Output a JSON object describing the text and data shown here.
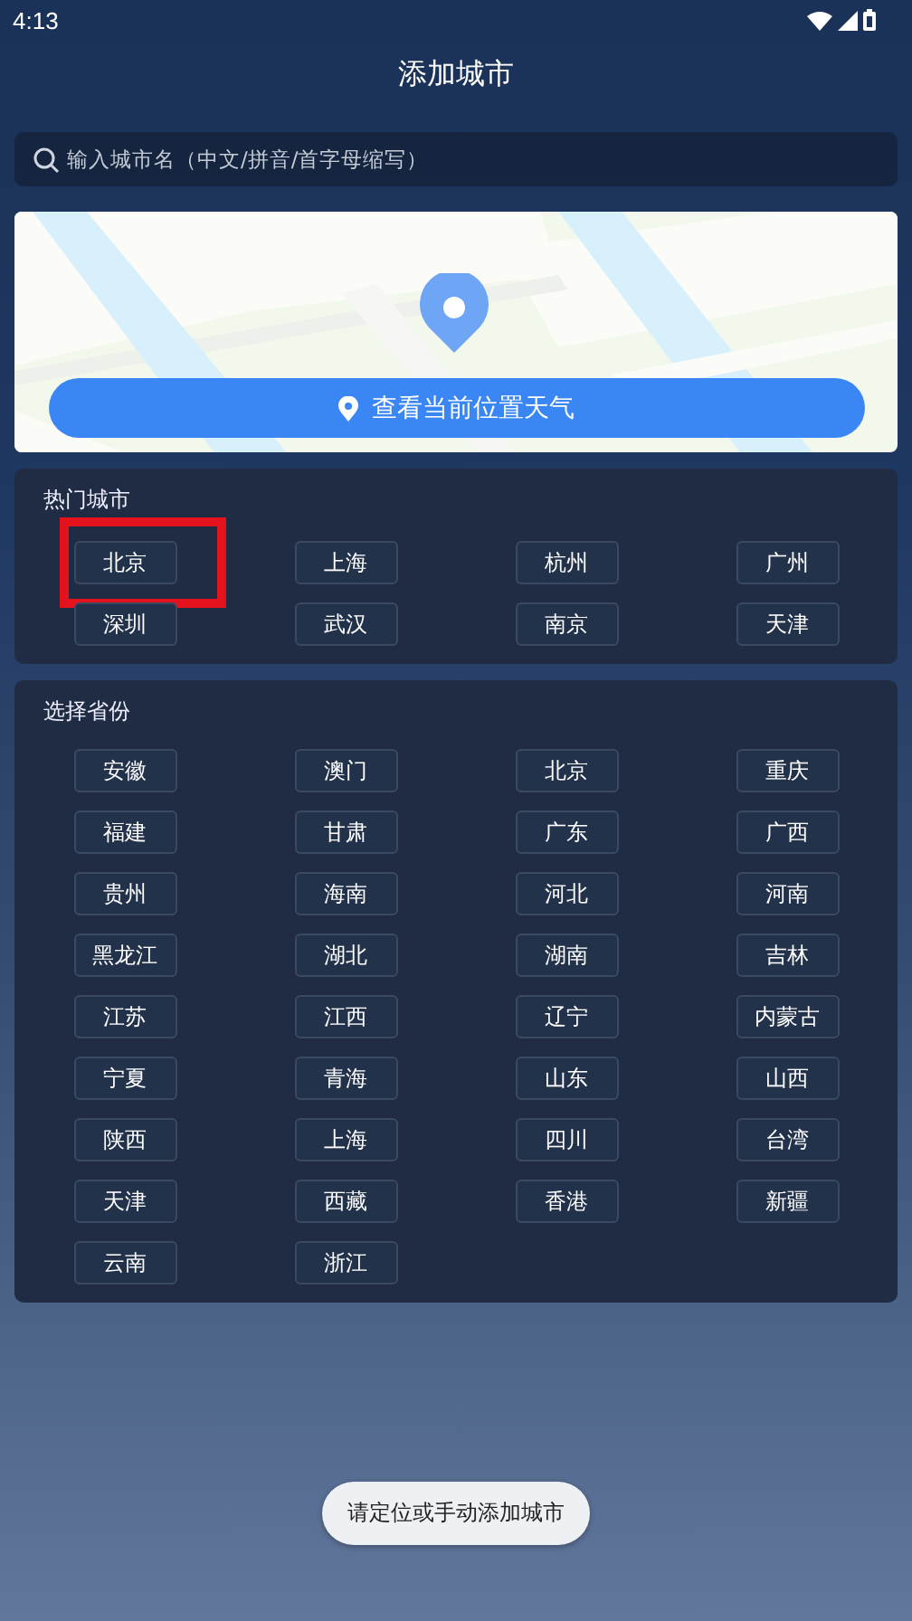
{
  "status_bar": {
    "time": "4:13"
  },
  "header": {
    "title": "添加城市"
  },
  "search": {
    "placeholder": "输入城市名（中文/拼音/首字母缩写）"
  },
  "map_card": {
    "kind": "picture",
    "button": "查看当前位置天气"
  },
  "hot_cities": {
    "title": "热门城市",
    "items": [
      {
        "label": "北京",
        "highlighted": true
      },
      {
        "label": "上海",
        "highlighted": false
      },
      {
        "label": "杭州",
        "highlighted": false
      },
      {
        "label": "广州",
        "highlighted": false
      },
      {
        "label": "深圳",
        "highlighted": false
      },
      {
        "label": "武汉",
        "highlighted": false
      },
      {
        "label": "南京",
        "highlighted": false
      },
      {
        "label": "天津",
        "highlighted": false
      }
    ]
  },
  "provinces": {
    "title": "选择省份",
    "items": [
      "安徽",
      "澳门",
      "北京",
      "重庆",
      "福建",
      "甘肃",
      "广东",
      "广西",
      "贵州",
      "海南",
      "河北",
      "河南",
      "黑龙江",
      "湖北",
      "湖南",
      "吉林",
      "江苏",
      "江西",
      "辽宁",
      "内蒙古",
      "宁夏",
      "青海",
      "山东",
      "山西",
      "陕西",
      "上海",
      "四川",
      "台湾",
      "天津",
      "西藏",
      "香港",
      "新疆",
      "云南",
      "浙江"
    ]
  },
  "toast": "请定位或手动添加城市"
}
